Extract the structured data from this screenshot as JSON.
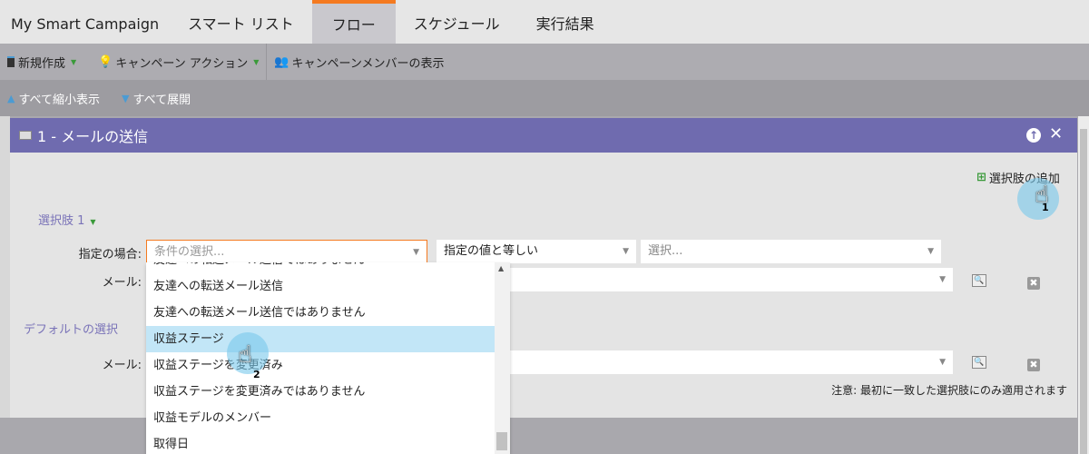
{
  "tabs": [
    {
      "label": "My Smart Campaign"
    },
    {
      "label": "スマート リスト"
    },
    {
      "label": "フロー",
      "active": true
    },
    {
      "label": "スケジュール"
    },
    {
      "label": "実行結果"
    }
  ],
  "toolbar": {
    "new": "新規作成",
    "campaign_actions": "キャンペーン アクション",
    "view_members": "キャンペーンメンバーの表示"
  },
  "bar2": {
    "collapse_all": "すべて縮小表示",
    "expand_all": "すべて展開"
  },
  "panel": {
    "title": "1 - メールの送信",
    "add_choice": "選択肢の追加",
    "choice_label": "選択肢 1",
    "if_label": "指定の場合:",
    "condition_placeholder": "条件の選択...",
    "operator": "指定の値と等しい",
    "value_placeholder": "選択...",
    "email_label": "メール:",
    "default_label": "デフォルトの選択",
    "email_label2": "メール:",
    "note": "注意: 最初に一致した選択肢にのみ適用されます"
  },
  "dropdown": {
    "items": [
      "友達への転送メール送信ではありません",
      "友達への転送メール送信",
      "友達への転送メール送信ではありません",
      "収益ステージ",
      "収益ステージを変更済み",
      "収益ステージを変更済みではありません",
      "収益モデルのメンバー",
      "取得日"
    ],
    "highlighted": "収益ステージ"
  },
  "callouts": {
    "step1": "1",
    "step2": "2"
  },
  "colors": {
    "accent": "#f47a20",
    "panel_header": "#6f6baf",
    "highlight": "#c2e6f7"
  }
}
